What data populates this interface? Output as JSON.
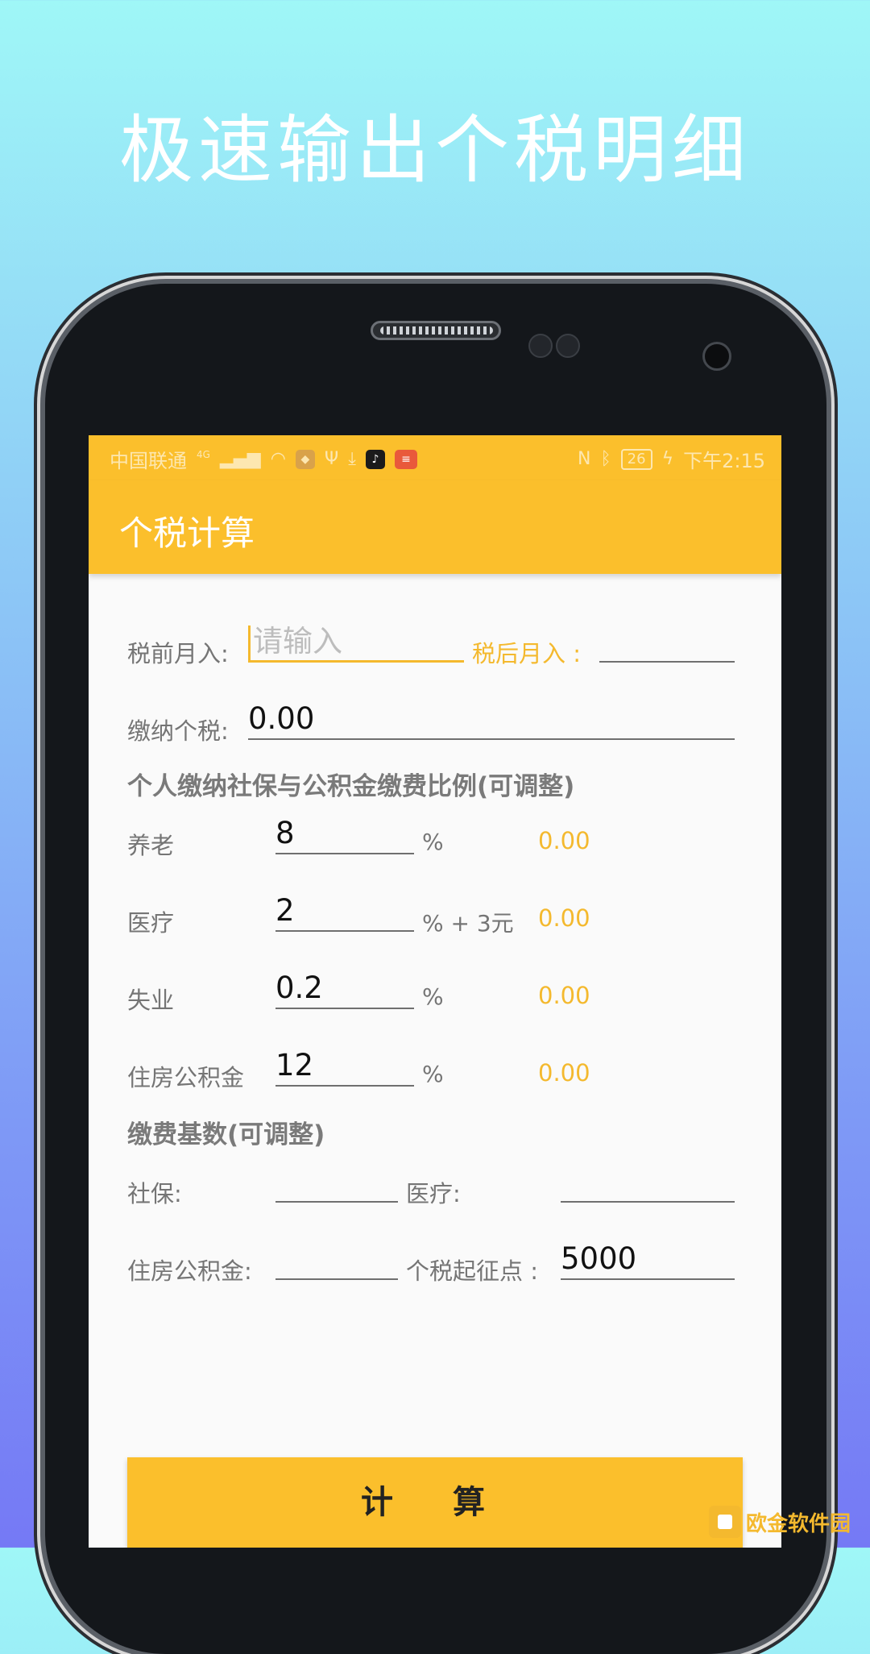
{
  "promo": {
    "title": "极速输出个税明细"
  },
  "statusbar": {
    "carrier": "中国联通",
    "network": "4G",
    "battery": "26",
    "time": "下午2:15"
  },
  "appbar": {
    "title": "个税计算"
  },
  "form": {
    "pretax_label": "税前月入:",
    "pretax_placeholder": "请输入",
    "aftertax_label": "税后月入 :",
    "aftertax_value": "",
    "tax_label": "缴纳个税:",
    "tax_value": "0.00",
    "section_rates": "个人缴纳社保与公积金缴费比例(可调整)",
    "rows": [
      {
        "label": "养老",
        "value": "8",
        "unit": "%",
        "amount": "0.00"
      },
      {
        "label": "医疗",
        "value": "2",
        "unit": "% + 3元",
        "amount": "0.00"
      },
      {
        "label": "失业",
        "value": "0.2",
        "unit": "%",
        "amount": "0.00"
      },
      {
        "label": "住房公积金",
        "value": "12",
        "unit": "%",
        "amount": "0.00"
      }
    ],
    "section_base": "缴费基数(可调整)",
    "social_label": "社保:",
    "social_value": "",
    "medical_label": "医疗:",
    "medical_value": "",
    "housing_label": "住房公积金:",
    "housing_value": "",
    "threshold_label": "个税起征点 :",
    "threshold_value": "5000"
  },
  "button": {
    "calculate": "计 算"
  },
  "watermark": {
    "text": "欧金软件园"
  }
}
